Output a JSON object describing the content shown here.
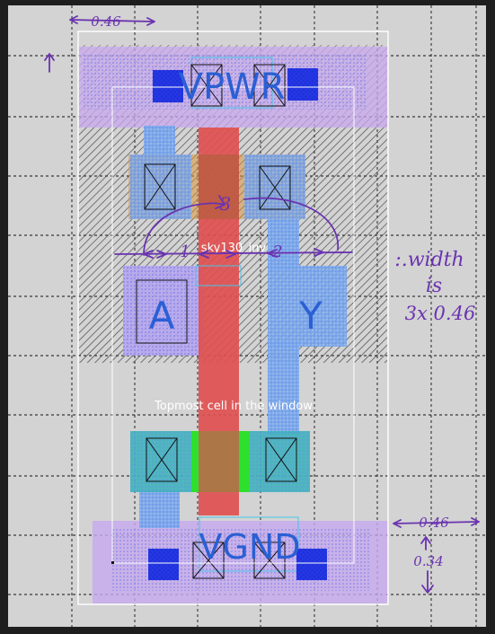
{
  "cell_name": "sky130_inv",
  "window_caption": "Topmost cell in the window",
  "pins": {
    "power": "VPWR",
    "ground": "VGND",
    "input": "A",
    "output": "Y"
  },
  "annotations": {
    "top_dim": "0.46",
    "right_dim": "0.46",
    "height_dim": "0.34",
    "gap_1": "1",
    "gap_2": "2",
    "gap_3": "3",
    "note_line1": ":.width",
    "note_line2": "is",
    "note_line3": "3x 0.46"
  },
  "colors": {
    "background": "#d3d3d3",
    "grid": "#111111",
    "poly": "#e05050",
    "diffusion": "#3fb6b8",
    "implant": "#2ee02e",
    "local_interconnect": "#8ab4f0",
    "metal1": "#b7a6ef",
    "contact": "#1c30e0",
    "annotation_ink": "#6a33b0"
  }
}
